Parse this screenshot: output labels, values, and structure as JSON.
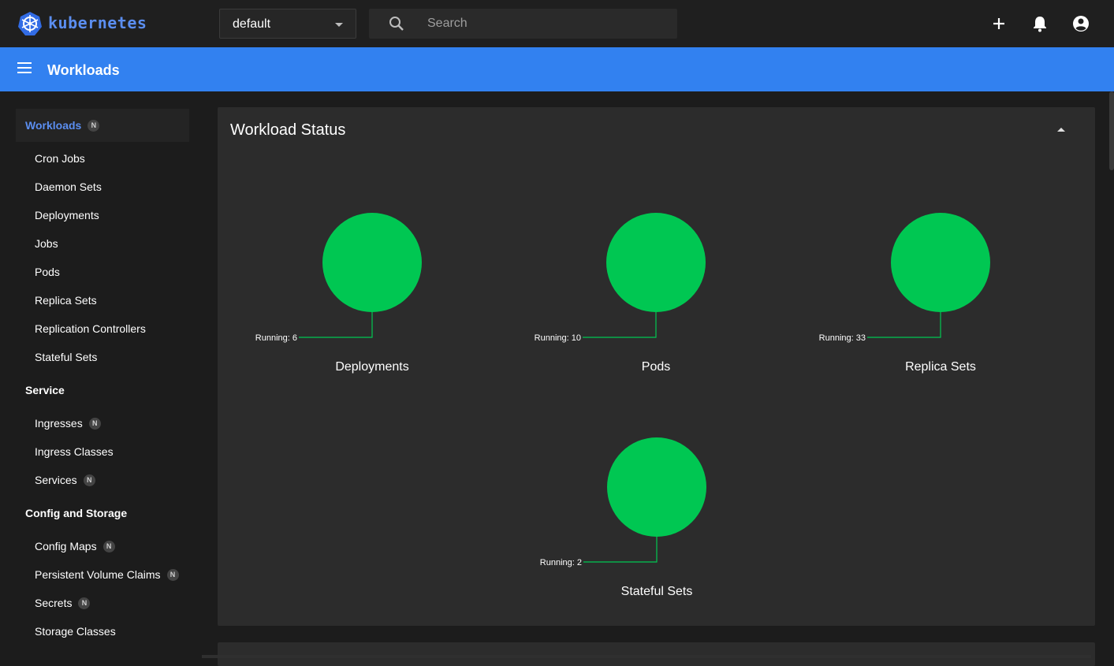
{
  "topbar": {
    "brand": "kubernetes",
    "namespace": "default",
    "search_placeholder": "Search"
  },
  "appbar": {
    "title": "Workloads"
  },
  "sidebar": {
    "groups": [
      {
        "label": "Workloads",
        "badge": "N",
        "active": true,
        "items": [
          "Cron Jobs",
          "Daemon Sets",
          "Deployments",
          "Jobs",
          "Pods",
          "Replica Sets",
          "Replication Controllers",
          "Stateful Sets"
        ]
      },
      {
        "label": "Service",
        "items": [
          {
            "label": "Ingresses",
            "badge": "N"
          },
          {
            "label": "Ingress Classes"
          },
          {
            "label": "Services",
            "badge": "N"
          }
        ]
      },
      {
        "label": "Config and Storage",
        "items": [
          {
            "label": "Config Maps",
            "badge": "N"
          },
          {
            "label": "Persistent Volume Claims",
            "badge": "N"
          },
          {
            "label": "Secrets",
            "badge": "N"
          },
          {
            "label": "Storage Classes"
          }
        ]
      }
    ]
  },
  "workload_status": {
    "title": "Workload Status",
    "charts": [
      {
        "name": "Deployments",
        "running_label": "Running: 6",
        "running": 6
      },
      {
        "name": "Pods",
        "running_label": "Running: 10",
        "running": 10
      },
      {
        "name": "Replica Sets",
        "running_label": "Running: 33",
        "running": 33
      },
      {
        "name": "Stateful Sets",
        "running_label": "Running: 2",
        "running": 2
      }
    ]
  },
  "chart_data": [
    {
      "type": "pie",
      "title": "Deployments",
      "categories": [
        "Running"
      ],
      "values": [
        6
      ]
    },
    {
      "type": "pie",
      "title": "Pods",
      "categories": [
        "Running"
      ],
      "values": [
        10
      ]
    },
    {
      "type": "pie",
      "title": "Replica Sets",
      "categories": [
        "Running"
      ],
      "values": [
        33
      ]
    },
    {
      "type": "pie",
      "title": "Stateful Sets",
      "categories": [
        "Running"
      ],
      "values": [
        2
      ]
    }
  ],
  "colors": {
    "accent": "#3281f0",
    "running": "#00c752",
    "brand": "#5b8ef0"
  },
  "icons": {
    "logo": "kubernetes-helm-icon",
    "search": "search-icon",
    "add": "plus-icon",
    "notifications": "bell-icon",
    "account": "account-circle-icon",
    "menu": "hamburger-menu-icon"
  }
}
